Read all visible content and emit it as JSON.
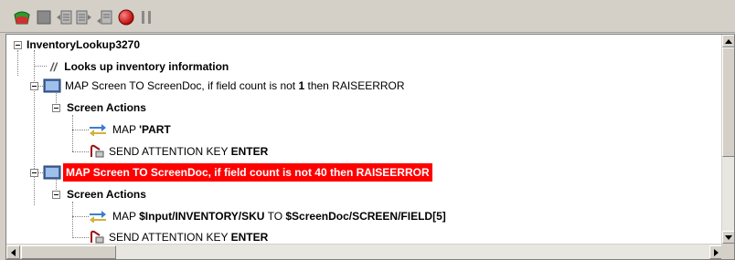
{
  "toolbar": {
    "buttons": [
      {
        "icon": "run-map-icon"
      },
      {
        "icon": "stop-icon"
      },
      {
        "icon": "step-into-icon"
      },
      {
        "icon": "step-over-icon"
      },
      {
        "icon": "step-out-icon"
      },
      {
        "icon": "breakpoint-icon"
      },
      {
        "icon": "pause-icon"
      }
    ]
  },
  "tree": {
    "root_label": "InventoryLookup3270",
    "comment_label": "Looks up inventory information",
    "map1": {
      "prefix": "MAP Screen TO ScreenDoc, if field count is not ",
      "count": "1",
      "suffix": " then RAISEERROR"
    },
    "actions1_label": "Screen Actions",
    "map_part": {
      "prefix": "MAP ",
      "value": "'PART"
    },
    "send1": {
      "prefix": "SEND ATTENTION KEY ",
      "key": "ENTER"
    },
    "map2_label": "MAP Screen TO ScreenDoc, if field count is not 40 then RAISEERROR",
    "actions2_label": "Screen Actions",
    "map_sku": {
      "prefix": "MAP ",
      "source": "$Input/INVENTORY/SKU",
      "mid": " TO ",
      "target": "$ScreenDoc/SCREEN/FIELD[5]"
    },
    "send2": {
      "prefix": "SEND ATTENTION KEY ",
      "key": "ENTER"
    }
  },
  "colors": {
    "selection": "#ff0000",
    "background": "#d4d0c8"
  }
}
